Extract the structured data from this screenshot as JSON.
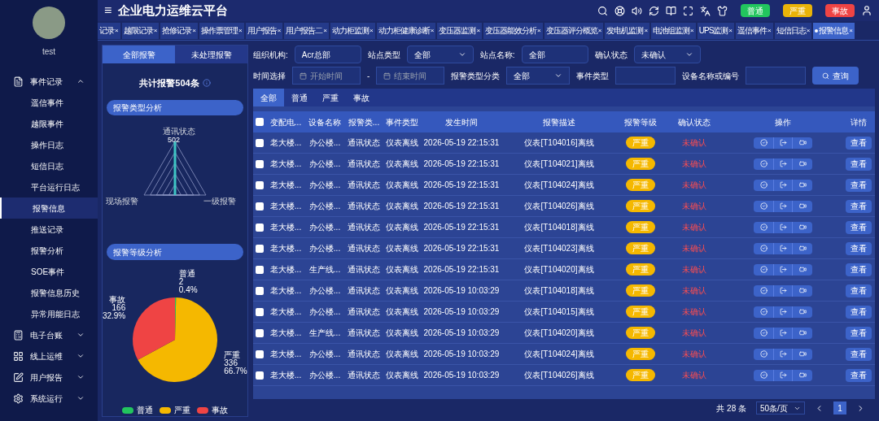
{
  "header": {
    "title": "企业电力运维云平台",
    "menu_glyph": "≡",
    "alarm_buttons": [
      {
        "label": "普通",
        "color": "#22c55e"
      },
      {
        "label": "严重",
        "color": "#eab308"
      },
      {
        "label": "事故",
        "color": "#ef4444"
      }
    ]
  },
  "user": {
    "name": "test"
  },
  "page_tabs": [
    {
      "label": "记录",
      "selected": false
    },
    {
      "label": "越限记录",
      "selected": false
    },
    {
      "label": "抢修记录",
      "selected": false
    },
    {
      "label": "操作票管理",
      "selected": false
    },
    {
      "label": "用户报告",
      "selected": false
    },
    {
      "label": "用户报告二",
      "selected": false
    },
    {
      "label": "动力柜监测",
      "selected": false
    },
    {
      "label": "动力柜健康诊断",
      "selected": false
    },
    {
      "label": "变压器监测",
      "selected": false
    },
    {
      "label": "变压器能效分析",
      "selected": false
    },
    {
      "label": "变压器评分概览",
      "selected": false
    },
    {
      "label": "发电机监测",
      "selected": false
    },
    {
      "label": "电池组监测",
      "selected": false
    },
    {
      "label": "UPS监测",
      "selected": false
    },
    {
      "label": "遥信事件",
      "selected": false
    },
    {
      "label": "短信日志",
      "selected": false
    },
    {
      "label": "报警信息",
      "selected": true
    }
  ],
  "tab_close_glyph": "×",
  "sidebar": {
    "items": [
      {
        "label": "事件记录",
        "expanded": true,
        "children": [
          {
            "label": "遥信事件",
            "selected": false
          },
          {
            "label": "越限事件",
            "selected": false
          },
          {
            "label": "操作日志",
            "selected": false
          },
          {
            "label": "短信日志",
            "selected": false
          },
          {
            "label": "平台运行日志",
            "selected": false
          },
          {
            "label": "报警信息",
            "selected": true
          },
          {
            "label": "推送记录",
            "selected": false
          },
          {
            "label": "报警分析",
            "selected": false
          },
          {
            "label": "SOE事件",
            "selected": false
          },
          {
            "label": "报警信息历史",
            "selected": false
          },
          {
            "label": "异常用能日志",
            "selected": false
          }
        ]
      },
      {
        "label": "电子台账",
        "expanded": false
      },
      {
        "label": "线上运维",
        "expanded": false
      },
      {
        "label": "用户报告",
        "expanded": false
      },
      {
        "label": "系统运行",
        "expanded": false
      }
    ]
  },
  "alarm_panel": {
    "tabs": [
      {
        "label": "全部报警",
        "selected": true
      },
      {
        "label": "未处理报警",
        "selected": false
      }
    ],
    "total": "共计报警504条",
    "type_section": "报警类型分析",
    "radar": {
      "labels": [
        "通讯状态",
        "现场报警",
        "一级报警"
      ],
      "peak": "502"
    },
    "level_section": "报警等级分析",
    "chart_data": {
      "type": "pie",
      "categories": [
        "普通",
        "严重",
        "事故"
      ],
      "series": [
        {
          "values": [
            2,
            336,
            166
          ]
        }
      ],
      "colors": [
        "#22c55e",
        "#f5b800",
        "#ef4444"
      ],
      "value_labels": [
        "0.4%",
        "66.7%",
        "32.9%"
      ],
      "data_labels": true
    }
  },
  "filters": [
    {
      "kind": "input",
      "label": "组织机构:",
      "value": "Acr总部"
    },
    {
      "kind": "select",
      "label": "站点类型",
      "value": "全部"
    },
    {
      "kind": "input",
      "label": "站点名称:",
      "value": "全部"
    },
    {
      "kind": "select",
      "label": "确认状态",
      "value": "未确认"
    }
  ],
  "filters_row2": {
    "time_label": "时间选择",
    "start_placeholder": "开始时间",
    "dash": "-",
    "end_placeholder": "结束时间",
    "category_label": "报警类型分类",
    "category_value": "全部",
    "event_label": "事件类型",
    "device_label": "设备名称或编号",
    "search_button": "查询"
  },
  "level_tabs": [
    {
      "label": "全部",
      "selected": true
    },
    {
      "label": "普通",
      "selected": false
    },
    {
      "label": "严重",
      "selected": false
    },
    {
      "label": "事故",
      "selected": false
    }
  ],
  "table": {
    "select_all_checked": false,
    "columns": [
      "变配电...",
      "设备名称",
      "报警类...",
      "事件类型",
      "发生时间",
      "报警描述",
      "报警等级",
      "确认状态",
      "操作",
      "详情"
    ],
    "rows": [
      {
        "checked": false,
        "cells": [
          "老大楼...",
          "办公楼...",
          "通讯状态",
          "仪表离线",
          "2026-05-19 22:15:31",
          "仪表[T104016]离线",
          "严重",
          "未确认"
        ],
        "detail": "查看"
      },
      {
        "checked": false,
        "cells": [
          "老大楼...",
          "办公楼...",
          "通讯状态",
          "仪表离线",
          "2026-05-19 22:15:31",
          "仪表[T104021]离线",
          "严重",
          "未确认"
        ],
        "detail": "查看"
      },
      {
        "checked": false,
        "cells": [
          "老大楼...",
          "办公楼...",
          "通讯状态",
          "仪表离线",
          "2026-05-19 22:15:31",
          "仪表[T104024]离线",
          "严重",
          "未确认"
        ],
        "detail": "查看"
      },
      {
        "checked": false,
        "cells": [
          "老大楼...",
          "办公楼...",
          "通讯状态",
          "仪表离线",
          "2026-05-19 22:15:31",
          "仪表[T104026]离线",
          "严重",
          "未确认"
        ],
        "detail": "查看"
      },
      {
        "checked": false,
        "cells": [
          "老大楼...",
          "办公楼...",
          "通讯状态",
          "仪表离线",
          "2026-05-19 22:15:31",
          "仪表[T104018]离线",
          "严重",
          "未确认"
        ],
        "detail": "查看"
      },
      {
        "checked": false,
        "cells": [
          "老大楼...",
          "办公楼...",
          "通讯状态",
          "仪表离线",
          "2026-05-19 22:15:31",
          "仪表[T104023]离线",
          "严重",
          "未确认"
        ],
        "detail": "查看"
      },
      {
        "checked": false,
        "cells": [
          "老大楼...",
          "生产线...",
          "通讯状态",
          "仪表离线",
          "2026-05-19 22:15:31",
          "仪表[T104020]离线",
          "严重",
          "未确认"
        ],
        "detail": "查看"
      },
      {
        "checked": false,
        "cells": [
          "老大楼...",
          "办公楼...",
          "通讯状态",
          "仪表离线",
          "2026-05-19 10:03:29",
          "仪表[T104018]离线",
          "严重",
          "未确认"
        ],
        "detail": "查看"
      },
      {
        "checked": false,
        "cells": [
          "老大楼...",
          "办公楼...",
          "通讯状态",
          "仪表离线",
          "2026-05-19 10:03:29",
          "仪表[T104015]离线",
          "严重",
          "未确认"
        ],
        "detail": "查看"
      },
      {
        "checked": false,
        "cells": [
          "老大楼...",
          "生产线...",
          "通讯状态",
          "仪表离线",
          "2026-05-19 10:03:29",
          "仪表[T104020]离线",
          "严重",
          "未确认"
        ],
        "detail": "查看"
      },
      {
        "checked": false,
        "cells": [
          "老大楼...",
          "办公楼...",
          "通讯状态",
          "仪表离线",
          "2026-05-19 10:03:29",
          "仪表[T104024]离线",
          "严重",
          "未确认"
        ],
        "detail": "查看"
      },
      {
        "checked": false,
        "cells": [
          "老大楼...",
          "办公楼...",
          "通讯状态",
          "仪表离线",
          "2026-05-19 10:03:29",
          "仪表[T104026]离线",
          "严重",
          "未确认"
        ],
        "detail": "查看"
      }
    ]
  },
  "pagination": {
    "total": "共 28 条",
    "page_size": "50条/页",
    "pages": [
      {
        "label": "1",
        "selected": true
      }
    ]
  }
}
